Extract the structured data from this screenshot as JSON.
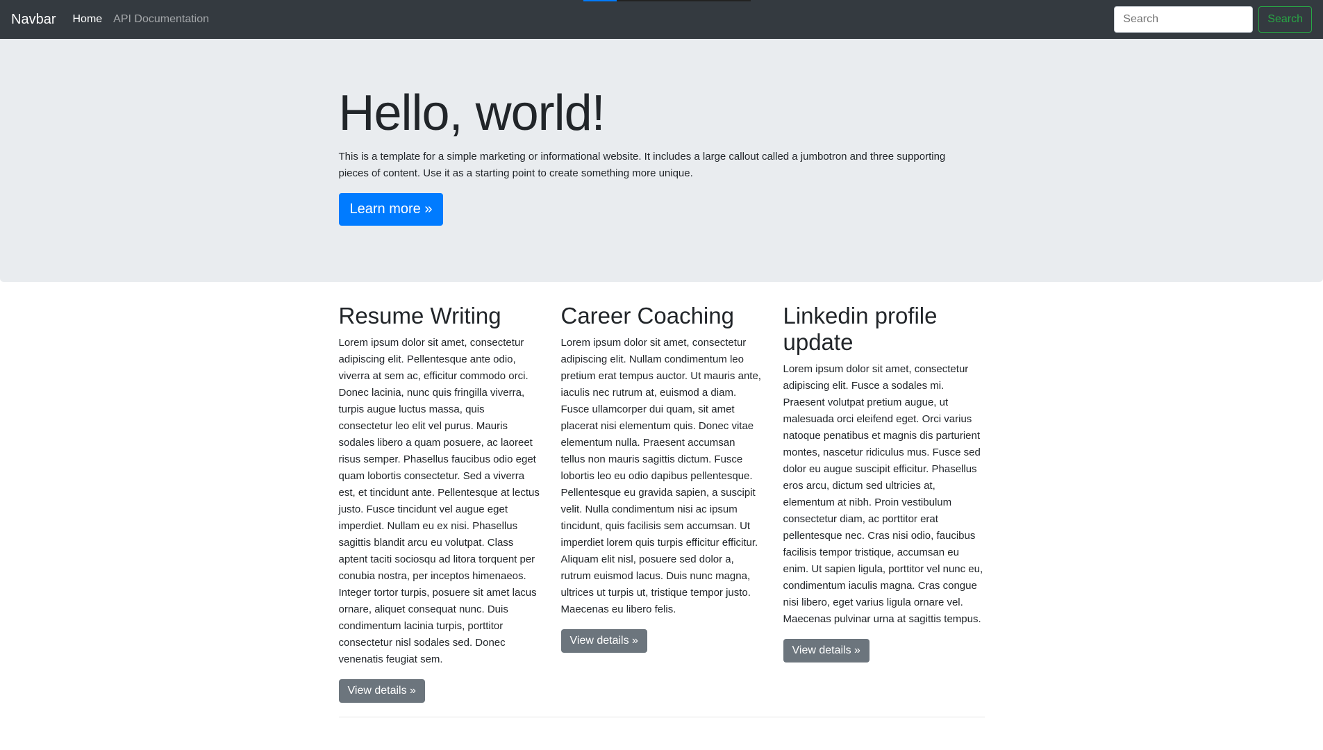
{
  "loading_bar": {
    "progress": 0.2,
    "color": "#007bff"
  },
  "navbar": {
    "brand": "Navbar",
    "links": [
      "Home",
      "API Documentation"
    ],
    "search_placeholder": "Search",
    "search_button": "Search"
  },
  "jumbotron": {
    "title": "Hello, world!",
    "lead": "This is a template for a simple marketing or informational website. It includes a large callout called a jumbotron and three supporting pieces of content. Use it as a starting point to create something more unique.",
    "button": "Learn more »"
  },
  "columns": [
    {
      "title": "Resume Writing",
      "text": "Lorem ipsum dolor sit amet, consectetur adipiscing elit. Pellentesque ante odio, viverra at sem ac, efficitur commodo orci. Donec lacinia, nunc quis fringilla viverra, turpis augue luctus massa, quis consectetur leo elit vel purus. Mauris sodales libero a quam posuere, ac laoreet risus semper. Phasellus faucibus odio eget quam lobortis consectetur. Sed a viverra est, et tincidunt ante. Pellentesque at lectus justo. Fusce tincidunt vel augue eget imperdiet. Nullam eu ex nisi. Phasellus sagittis blandit arcu eu volutpat. Class aptent taciti sociosqu ad litora torquent per conubia nostra, per inceptos himenaeos. Integer tortor turpis, posuere sit amet lacus ornare, aliquet consequat nunc. Duis condimentum lacinia turpis, porttitor consectetur nisl sodales sed. Donec venenatis feugiat sem.",
      "button": "View details »"
    },
    {
      "title": "Career Coaching",
      "text": "Lorem ipsum dolor sit amet, consectetur adipiscing elit. Nullam condimentum leo pretium erat tempus auctor. Ut mauris ante, iaculis nec rutrum at, euismod a diam. Fusce ullamcorper dui quam, sit amet placerat nisi elementum quis. Donec vitae elementum nulla. Praesent accumsan tellus non mauris sagittis dictum. Fusce lobortis leo eu odio dapibus pellentesque. Pellentesque eu gravida sapien, a suscipit velit. Nulla condimentum nisi ac ipsum tincidunt, quis facilisis sem accumsan. Ut imperdiet lorem quis turpis efficitur efficitur. Aliquam elit nisl, posuere sed dolor a, rutrum euismod lacus. Duis nunc magna, ultrices ut turpis ut, tristique tempor justo. Maecenas eu libero felis.",
      "button": "View details »"
    },
    {
      "title": "Linkedin profile update",
      "text": "Lorem ipsum dolor sit amet, consectetur adipiscing elit. Fusce a sodales mi. Praesent volutpat pretium augue, ut malesuada orci eleifend eget. Orci varius natoque penatibus et magnis dis parturient montes, nascetur ridiculus mus. Fusce sed dolor eu augue suscipit efficitur. Phasellus eros arcu, dictum sed ultricies at, elementum at nibh. Proin vestibulum consectetur diam, ac porttitor erat pellentesque nec. Cras nisi odio, faucibus facilisis tempor tristique, accumsan eu enim. Ut sapien ligula, porttitor vel nunc eu, condimentum iaculis magna. Cras congue nisi libero, eget varius ligula ornare vel. Maecenas pulvinar urna at sagittis tempus.",
      "button": "View details »"
    }
  ]
}
